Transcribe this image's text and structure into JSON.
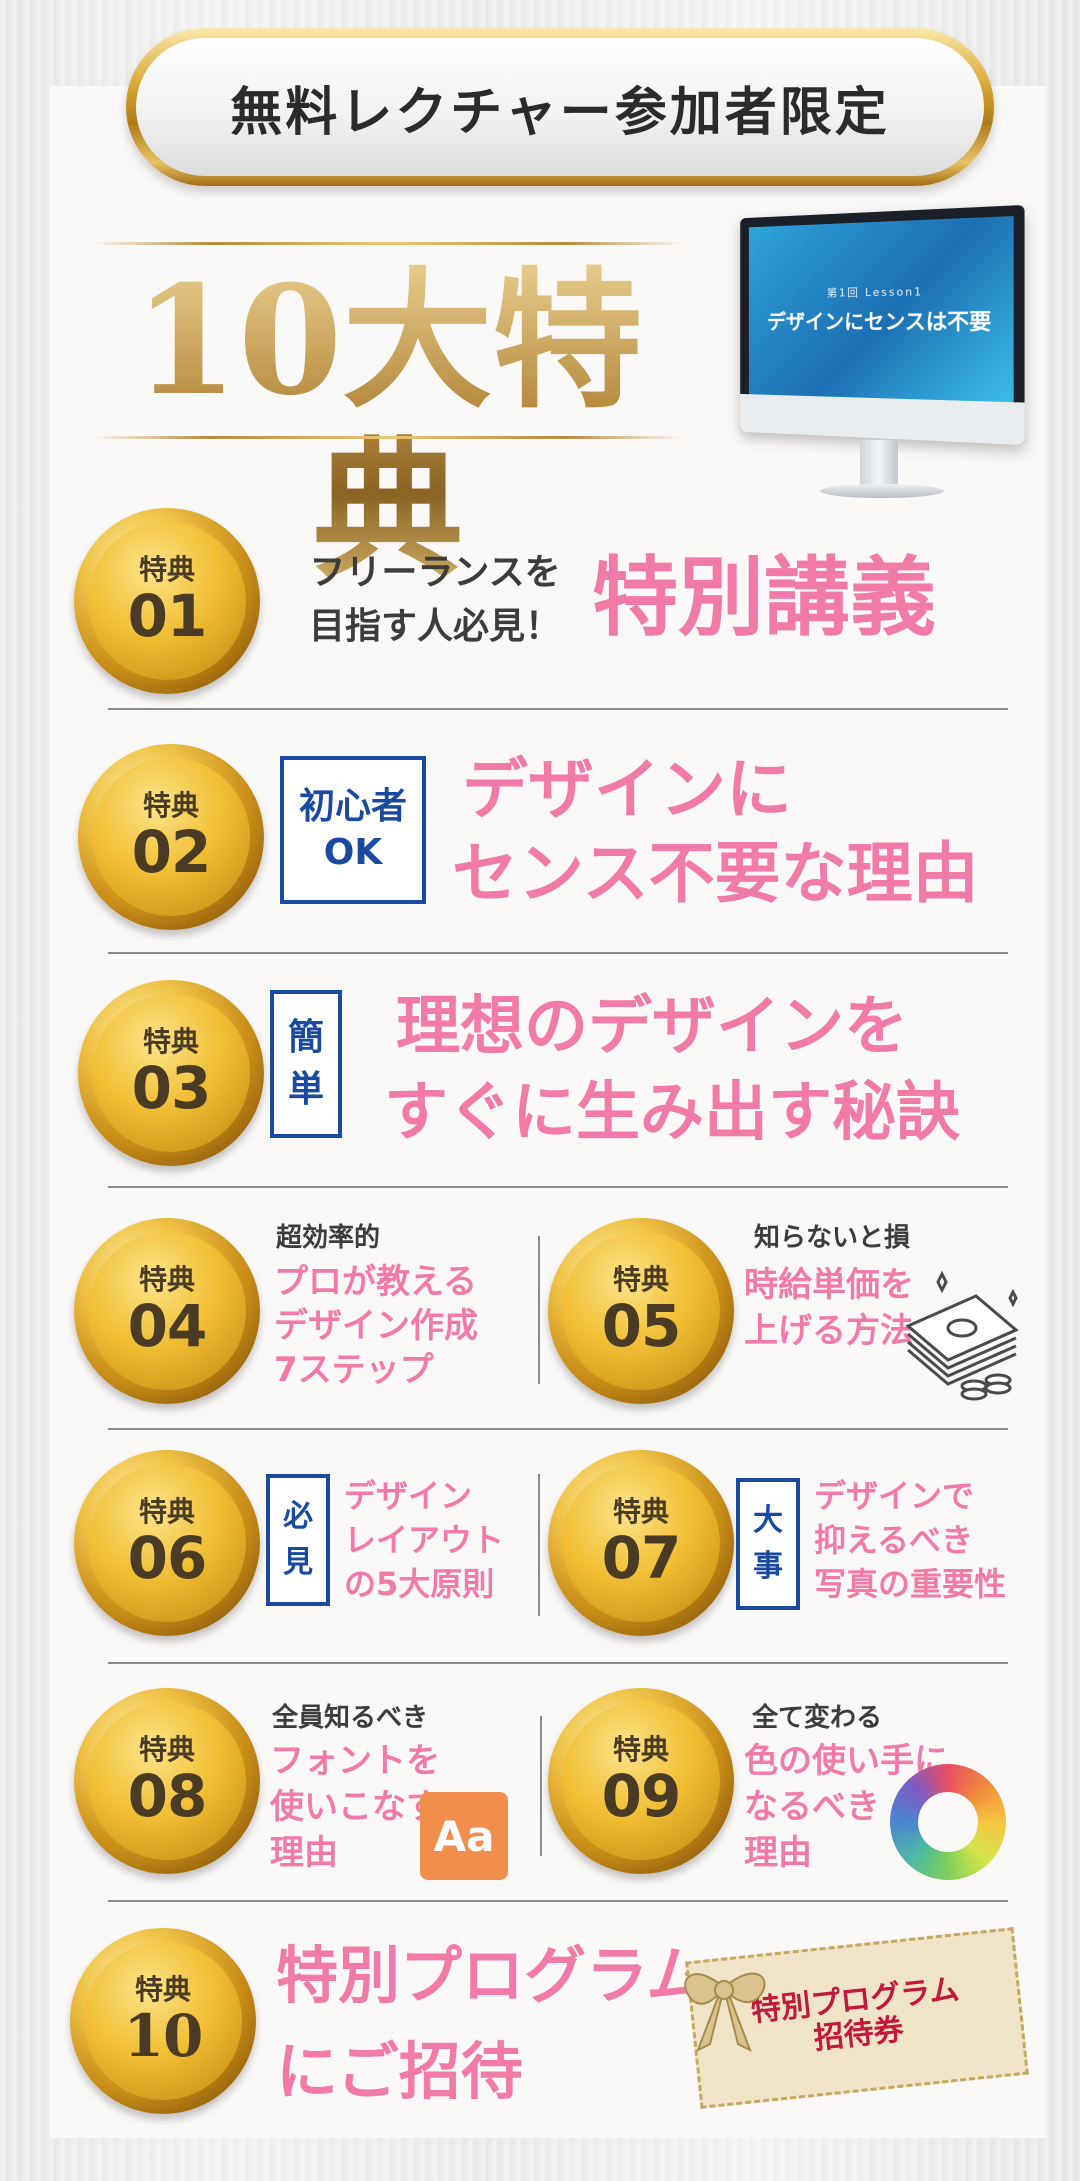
{
  "banner": {
    "text": "無料レクチャー参加者限定"
  },
  "title": "10大特典",
  "monitor": {
    "lesson": "第1回 Lesson1",
    "screen_title": "デザインにセンスは不要"
  },
  "medal_label": "特典",
  "items": [
    {
      "num": "01",
      "sub_lines": [
        "フリーランスを",
        "目指す人必見！"
      ],
      "main_lines": [
        "特別講義"
      ]
    },
    {
      "num": "02",
      "badge": [
        "初心者",
        "OK"
      ],
      "main_lines": [
        "デザインに",
        "センス不要な理由"
      ]
    },
    {
      "num": "03",
      "badge": [
        "簡",
        "単"
      ],
      "main_lines": [
        "理想のデザインを",
        "すぐに生み出す秘訣"
      ]
    },
    {
      "num": "04",
      "sub_lines": [
        "超効率的"
      ],
      "main_lines": [
        "プロが教える",
        "デザイン作成",
        "7ステップ"
      ]
    },
    {
      "num": "05",
      "sub_lines": [
        "知らないと損"
      ],
      "main_lines": [
        "時給単価を",
        "上げる方法"
      ]
    },
    {
      "num": "06",
      "badge": [
        "必",
        "見"
      ],
      "main_lines": [
        "デザイン",
        "レイアウト",
        "の5大原則"
      ]
    },
    {
      "num": "07",
      "badge": [
        "大",
        "事"
      ],
      "main_lines": [
        "デザインで",
        "抑えるべき",
        "写真の重要性"
      ]
    },
    {
      "num": "08",
      "sub_lines": [
        "全員知るべき"
      ],
      "main_lines": [
        "フォントを",
        "使いこなす",
        "理由"
      ],
      "icon_text": "Aa"
    },
    {
      "num": "09",
      "sub_lines": [
        "全て変わる"
      ],
      "main_lines": [
        "色の使い手に",
        "なるべき",
        "理由"
      ]
    },
    {
      "num": "10",
      "main_lines": [
        "特別プログラム",
        "にご招待"
      ],
      "ticket": [
        "特別プログラム",
        "招待券"
      ]
    }
  ],
  "colors": {
    "pink": "#f27aa9",
    "blue": "#1a4aa0",
    "gold": "#d39a1c",
    "text": "#3c3c3c"
  }
}
